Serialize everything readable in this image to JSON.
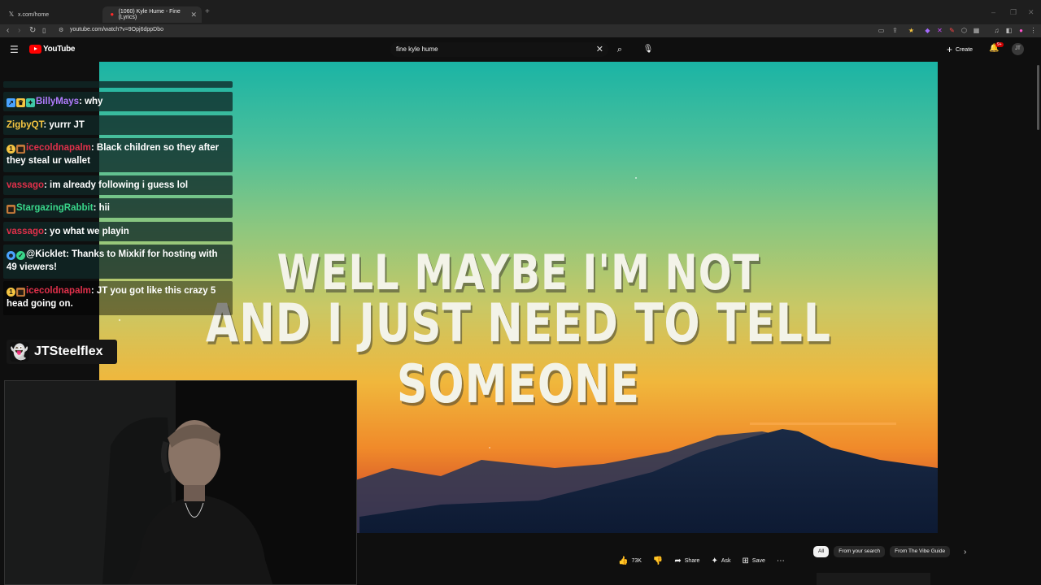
{
  "browser": {
    "tabs": [
      {
        "label": "x.com/home",
        "icon": "x-logo-icon"
      },
      {
        "label": "(1060) Kyle Hume - Fine (Lyrics)",
        "icon": "youtube-icon"
      }
    ],
    "url": "youtube.com/watch?v=9Opj6dppDbo"
  },
  "youtube": {
    "logo": "YouTube",
    "search_query": "fine kyle hume",
    "create_label": "Create",
    "notif_count": "9+",
    "avatar": "JT"
  },
  "video": {
    "lyric_line1": "WELL MAYBE I'M NOT",
    "lyric_line2": "AND I JUST NEED TO TELL SOMEONE"
  },
  "chat": {
    "messages": [
      {
        "user": "BillyMays",
        "text": ": why"
      },
      {
        "user": "ZigbyQT",
        "text": ": yurrr JT"
      },
      {
        "user": "icecoldnapalm",
        "text": ": Black children so they after they steal ur wallet"
      },
      {
        "user": "vassago",
        "text": ": im already following i guess lol"
      },
      {
        "user": "StargazingRabbit",
        "text": ": hii"
      },
      {
        "user": "vassago",
        "text": ": yo what we playin"
      },
      {
        "user": "@Kicklet",
        "text": ": Thanks to Mixkif for hosting with 49 viewers!"
      },
      {
        "user": "icecoldnapalm",
        "text": ": JT you got like this crazy 5 head going on."
      }
    ]
  },
  "streamer": {
    "snap_handle": "JTSteelflex"
  },
  "actions": {
    "likes": "73K",
    "share": "Share",
    "ask": "Ask",
    "save": "Save"
  },
  "chips": [
    "All",
    "From your search",
    "From The Vibe Guide"
  ],
  "colors": {
    "yt_red": "#ff0000",
    "chat_bg": "#0f2826",
    "snap_yellow": "#fffc00"
  }
}
